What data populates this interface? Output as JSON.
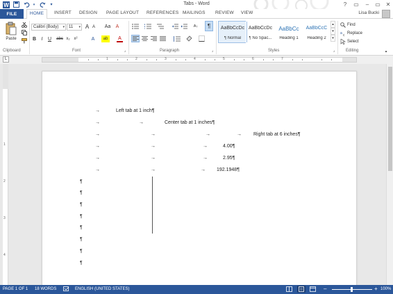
{
  "window": {
    "title": "Tabs - Word",
    "user_name": "Lisa Bucki"
  },
  "qat": {
    "word_icon": "word-logo-icon",
    "save_icon": "save-icon",
    "undo_icon": "undo-icon",
    "redo_icon": "redo-icon",
    "customize_icon": "customize-qat-icon"
  },
  "window_controls": {
    "help": "?",
    "ribbon_display": "▭",
    "minimize": "–",
    "restore": "▭",
    "close": "✕"
  },
  "tabs": [
    "FILE",
    "HOME",
    "INSERT",
    "DESIGN",
    "PAGE LAYOUT",
    "REFERENCES",
    "MAILINGS",
    "REVIEW",
    "VIEW"
  ],
  "active_tab": "HOME",
  "ribbon": {
    "clipboard": {
      "paste_label": "Paste",
      "group_label": "Clipboard"
    },
    "font": {
      "font_name": "Calibri (Body)",
      "font_size": "11",
      "grow": "A",
      "shrink": "A",
      "change_case": "Aa",
      "clear": "A",
      "bold": "B",
      "italic": "I",
      "underline": "U",
      "strike": "abc",
      "subscript": "x₂",
      "superscript": "x²",
      "effects": "A",
      "highlight": "ab",
      "font_color": "A",
      "group_label": "Font"
    },
    "paragraph": {
      "group_label": "Paragraph",
      "show_marks": "¶",
      "sort": "A↓"
    },
    "styles": {
      "group_label": "Styles",
      "items": [
        {
          "preview": "AaBbCcDc",
          "name": "¶ Normal"
        },
        {
          "preview": "AaBbCcDc",
          "name": "¶ No Spac..."
        },
        {
          "preview": "AaBbCc",
          "name": "Heading 1"
        },
        {
          "preview": "AaBbCcC",
          "name": "Heading 2"
        }
      ]
    },
    "editing": {
      "group_label": "Editing",
      "find": "Find",
      "replace": "Replace",
      "select": "Select"
    }
  },
  "ruler": {
    "tab_selector": "L",
    "numbers": [
      "1",
      "2",
      "3",
      "4",
      "5",
      "6",
      "7"
    ]
  },
  "vruler": {
    "numbers": [
      "1",
      "2",
      "3",
      "4"
    ]
  },
  "document": {
    "arrow_glyph": "→",
    "pilcrow": "¶",
    "line1": "Left tab at 1 inch¶",
    "line2": "Center tab at 1 inches¶",
    "line3": "Right tab at 6 inches¶",
    "line4": "4.00¶",
    "line5": "2.95¶",
    "line6": "192.1948¶"
  },
  "status": {
    "page": "PAGE 1 OF 1",
    "words": "18 WORDS",
    "language": "ENGLISH (UNITED STATES)",
    "zoom": "100%",
    "zoom_level": 1.0
  },
  "colors": {
    "accent": "#2b579a",
    "status_bar": "#2b579a",
    "workspace": "#e8e8e8"
  }
}
